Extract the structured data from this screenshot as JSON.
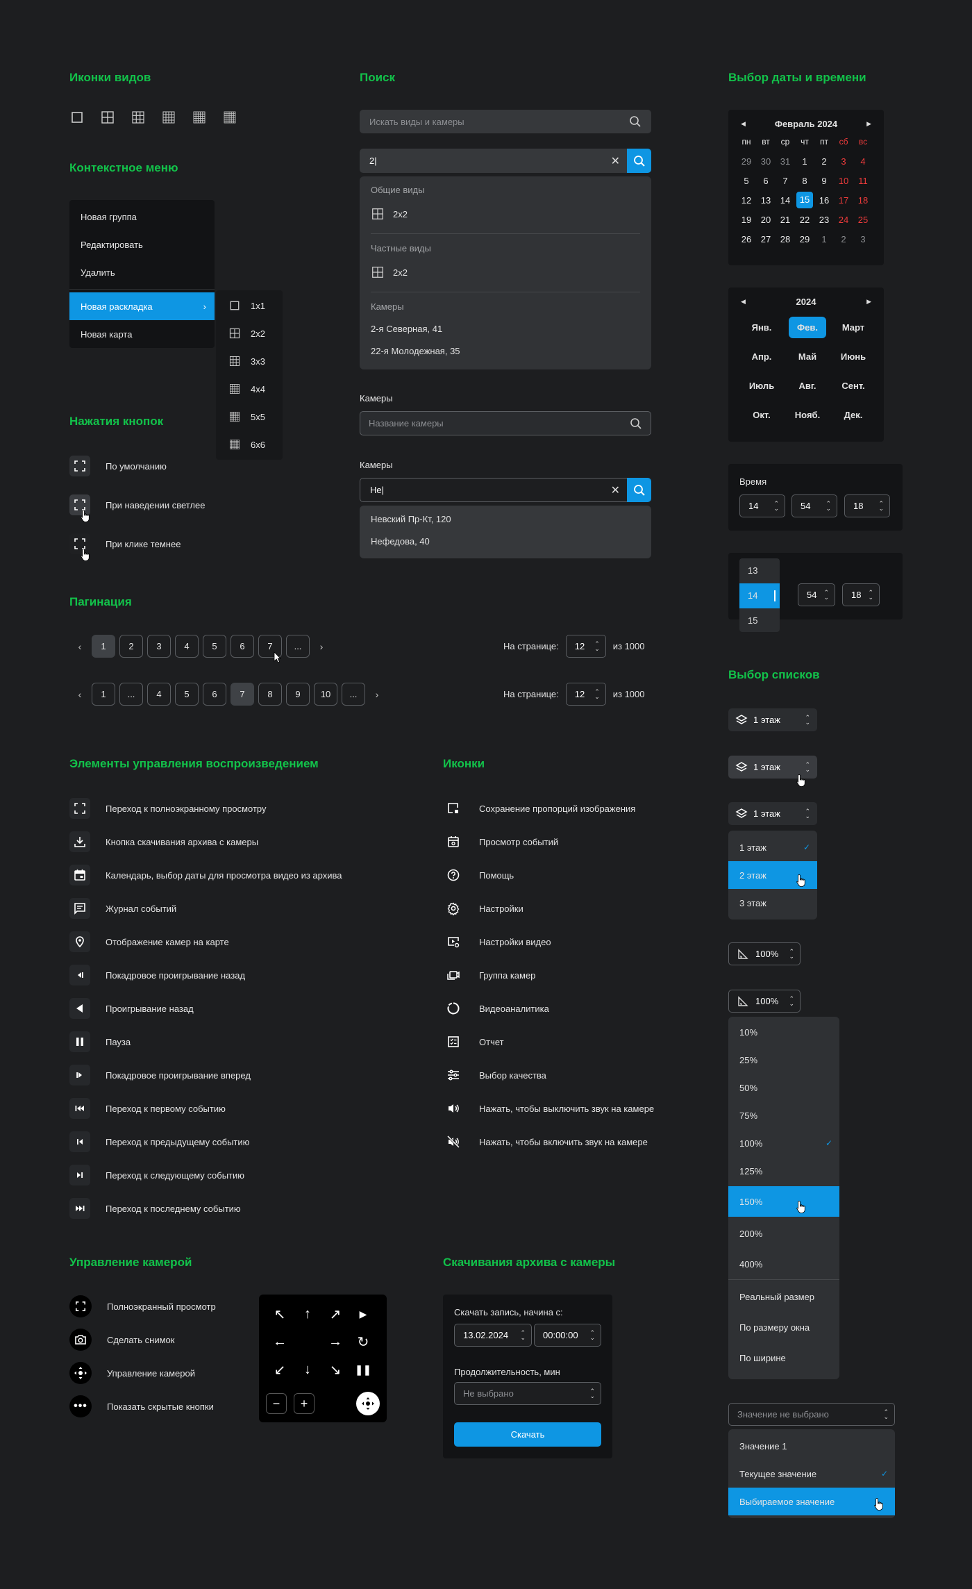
{
  "sections": {
    "view_icons": "Иконки видов",
    "search": "Поиск",
    "datetime": "Выбор даты и времени",
    "context_menu": "Контекстное меню",
    "buttons": "Нажатия кнопок",
    "pagination": "Пагинация",
    "playback": "Элементы управления воспроизведением",
    "icons": "Иконки",
    "list_select": "Выбор списков",
    "camera_control": "Управление камерой",
    "archive": "Скачивания архива с камеры"
  },
  "context_menu": {
    "items": [
      "Новая группа",
      "Редактировать",
      "Удалить"
    ],
    "layout": "Новая раскладка",
    "map": "Новая карта",
    "submenu": [
      "1x1",
      "2x2",
      "3x3",
      "4x4",
      "5x5",
      "6x6"
    ]
  },
  "button_states": [
    "По умолчанию",
    "При наведении светлее",
    "При клике темнее"
  ],
  "search": {
    "placeholder": "Искать виды и камеры",
    "query": "2|",
    "group1": "Общие виды",
    "group1_item": "2x2",
    "group2": "Частные виды",
    "group2_item": "2x2",
    "group3": "Камеры",
    "cameras": [
      "2-я Северная, 41",
      "22-я Молодежная, 35"
    ],
    "cam_label1": "Камеры",
    "cam_placeholder": "Название камеры",
    "cam_label2": "Камеры",
    "cam_query": "Не|",
    "cam_results": [
      "Невский Пр-Кт, 120",
      "Нефедова, 40"
    ]
  },
  "calendar": {
    "month": "Февраль 2024",
    "weekdays": [
      "пн",
      "вт",
      "ср",
      "чт",
      "пт",
      "сб",
      "вс"
    ],
    "weeks": [
      [
        "29",
        "30",
        "31",
        "1",
        "2",
        "3",
        "4"
      ],
      [
        "5",
        "6",
        "7",
        "8",
        "9",
        "10",
        "11"
      ],
      [
        "12",
        "13",
        "14",
        "15",
        "16",
        "17",
        "18"
      ],
      [
        "19",
        "20",
        "21",
        "22",
        "23",
        "24",
        "25"
      ],
      [
        "26",
        "27",
        "28",
        "29",
        "1",
        "2",
        "3"
      ]
    ],
    "year": "2024",
    "months": [
      "Янв.",
      "Фев.",
      "Март",
      "Апр.",
      "Май",
      "Июнь",
      "Июль",
      "Авг.",
      "Сент.",
      "Окт.",
      "Нояб.",
      "Дек."
    ]
  },
  "time": {
    "label": "Время",
    "h": "14",
    "m": "54",
    "s": "18",
    "h_list": [
      "13",
      "14",
      "15"
    ]
  },
  "pagination": {
    "row1": [
      "1",
      "2",
      "3",
      "4",
      "5",
      "6",
      "7",
      "..."
    ],
    "row2": [
      "1",
      "...",
      "4",
      "5",
      "6",
      "7",
      "8",
      "9",
      "10",
      "..."
    ],
    "per_page_label": "На странице:",
    "per_page": "12",
    "total": "из 1000"
  },
  "floors": {
    "value": "1 этаж",
    "items": [
      "1 этаж",
      "2 этаж",
      "3 этаж"
    ]
  },
  "zoom": {
    "value": "100%",
    "items": [
      "10%",
      "25%",
      "50%",
      "75%",
      "100%",
      "125%",
      "150%",
      "200%",
      "400%"
    ],
    "extra": [
      "Реальный размер",
      "По размеру окна",
      "По ширине"
    ]
  },
  "value_select": {
    "placeholder": "Значение не выбрано",
    "items": [
      "Значение 1",
      "Текущее значение",
      "Выбираемое значение"
    ]
  },
  "playback": [
    "Переход к полноэкранному просмотру",
    "Кнопка скачивания архива с камеры",
    "Календарь, выбор даты для просмотра видео из архива",
    "Журнал событий",
    "Отображение камер на карте",
    "Покадровое проигрывание назад",
    "Проигрывание назад",
    "Пауза",
    "Покадровое проигрывание вперед",
    "Переход к первому событию",
    "Переход к предыдущему событию",
    "Переход к следующему событию",
    "Переход к последнему событию"
  ],
  "icons": [
    "Сохранение пропорций изображения",
    "Просмотр событий",
    "Помощь",
    "Настройки",
    "Настройки видео",
    "Группа камер",
    "Видеоаналитика",
    "Отчет",
    "Выбор качества",
    "Нажать, чтобы выключить звук на камере",
    "Нажать, чтобы включить звук на камере"
  ],
  "camera_control": [
    "Полноэкранный просмотр",
    "Сделать снимок",
    "Управление камерой",
    "Показать скрытые кнопки"
  ],
  "archive": {
    "start_label": "Скачать запись, начина с:",
    "date": "13.02.2024",
    "time": "00:00:00",
    "duration_label": "Продолжительность, мин",
    "duration_placeholder": "Не выбрано",
    "button": "Скачать"
  }
}
